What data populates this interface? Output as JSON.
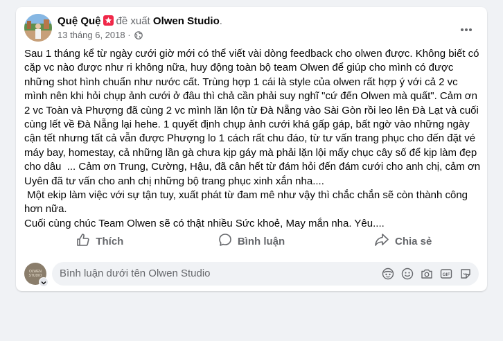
{
  "post": {
    "author": "Quệ Quệ",
    "verb": "đề xuất",
    "page_name": "Olwen Studio",
    "punct": ".",
    "date": "13 tháng 6, 2018",
    "separator": "·",
    "paragraphs": [
      "Sau 1 tháng kể từ ngày cưới giờ mới có thể viết vài dòng feedback cho olwen được. Không biết có cặp vc nào được như ri không nữa, huy động toàn bộ team Olwen để giúp cho mình có được những shot hình chuẩn như nước cất. Trùng hợp 1 cái là style của olwen rất hợp ý với cả 2 vc mình nên khi hỏi chụp ảnh cưới ở đâu thì chả cần phải suy nghĩ \"cứ đến Olwen mà quất\". Cảm ơn 2 vc Toàn và Phượng đã cùng 2 vc mình lăn lộn từ Đà Nẵng vào Sài Gòn rồi leo lên Đà Lạt và cuối cùng lết về Đà Nẵng lại hehe. 1 quyết định chụp ảnh cưới khá gấp gáp, bất ngờ vào những ngày cận tết nhưng tất cả vẫn được Phượng lo 1 cách rất chu đáo, từ tư vấn trang phục cho đến đặt vé máy bay, homestay, cả những lần gà chưa kịp gáy mà phải lặn lội mấy chục cây số để kịp làm đẹp cho dâu  ... Cảm ơn Trung, Cường, Hậu, đã cân hết từ đám hỏi đến đám cưới cho anh chị, cảm ơn Uyên đã tư vấn cho anh chị những bộ trang phục xinh xắn nha....",
      " Một ekip làm việc với sự tận tuy, xuất phát từ đam mê như vậy thì chắc chắn sẽ còn thành công hơn nữa.",
      "Cuối cùng chúc Team Olwen sẽ có thật nhiều Sức khoẻ, May mắn nha. Yêu...."
    ]
  },
  "actions": {
    "like": "Thích",
    "comment": "Bình luận",
    "share": "Chia sẻ"
  },
  "composer": {
    "placeholder": "Bình luận dưới tên Olwen Studio",
    "avatar_text_1": "OLWEN",
    "avatar_text_2": "STUDIO"
  },
  "colors": {
    "background": "#f0f2f5",
    "card": "#ffffff",
    "muted_text": "#65676b",
    "badge": "#f02849"
  },
  "icons": [
    "globe-icon",
    "more-icon",
    "like-icon",
    "comment-icon",
    "share-icon",
    "avatar-stickers-icon",
    "emoji-icon",
    "camera-icon",
    "gif-icon",
    "sticker-icon",
    "chevron-down-icon"
  ]
}
